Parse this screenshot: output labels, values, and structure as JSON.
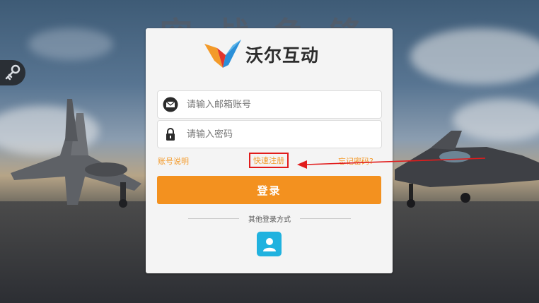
{
  "game": {
    "logo_text": "空战争锋"
  },
  "brand": {
    "name": "沃尔互动"
  },
  "form": {
    "email_placeholder": "请输入邮箱账号",
    "password_placeholder": "请输入密码"
  },
  "links": {
    "account_info": "账号说明",
    "quick_register": "快速注册",
    "forgot_password": "忘记密码?"
  },
  "login_button": "登录",
  "other_login": {
    "label": "其他登录方式"
  },
  "colors": {
    "accent": "#f3911f",
    "link": "#f39a29",
    "guest": "#20b2df",
    "annotation": "#e11c1c"
  },
  "icons": {
    "side": "key-icon",
    "email": "envelope-icon",
    "password": "lock-icon",
    "guest": "person-icon"
  }
}
